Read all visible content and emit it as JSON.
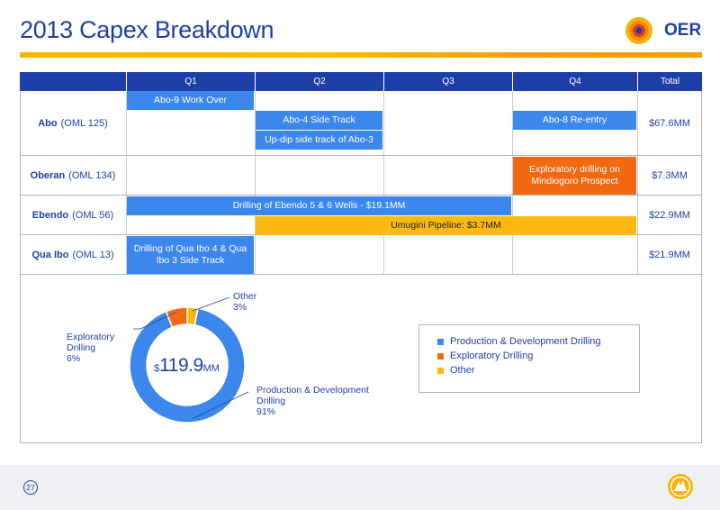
{
  "title": "2013 Capex Breakdown",
  "logo": {
    "text": "OER"
  },
  "footer": {
    "page": "27"
  },
  "colors": {
    "navy": "#1f3fa8",
    "blue": "#3b87eb",
    "orange": "#f06a14",
    "yellow": "#fcb912"
  },
  "schedule": {
    "columns": [
      "Q1",
      "Q2",
      "Q3",
      "Q4",
      "Total"
    ],
    "rows": [
      {
        "name": "Abo",
        "license": "(OML 125)",
        "total": "$67.6MM",
        "activities": [
          {
            "label": "Abo-9 Work Over",
            "start": "Q1",
            "end": "Q1",
            "color": "blue",
            "lane": 0
          },
          {
            "label": "Abo-4 Side Track",
            "start": "Q2",
            "end": "Q2",
            "color": "blue",
            "lane": 1
          },
          {
            "label": "Up-dip side track of Abo-3",
            "start": "Q2",
            "end": "Q2",
            "color": "blue",
            "lane": 2
          },
          {
            "label": "Abo-8 Re-entry",
            "start": "Q4",
            "end": "Q4",
            "color": "blue",
            "lane": 1
          }
        ]
      },
      {
        "name": "Oberan",
        "license": "(OML 134)",
        "total": "$7.3MM",
        "activities": [
          {
            "label": "Exploratory drilling on Mindiogoro Prospect",
            "start": "Q4",
            "end": "Q4",
            "color": "orange",
            "lane": 0
          }
        ]
      },
      {
        "name": "Ebendo",
        "license": "(OML 56)",
        "total": "$22.9MM",
        "activities": [
          {
            "label": "Drilling of Ebendo 5 & 6 Wells - $19.1MM",
            "start": "Q1",
            "end": "Q3",
            "color": "blue",
            "lane": 0
          },
          {
            "label": "Umugini Pipeline: $3.7MM",
            "start": "Q2",
            "end": "Q4",
            "color": "yellow",
            "lane": 1
          }
        ]
      },
      {
        "name": "Qua Ibo",
        "license": "(OML 13)",
        "total": "$21.9MM",
        "activities": [
          {
            "label": "Drilling of Qua Ibo 4 & Qua Ibo 3 Side Track",
            "start": "Q1",
            "end": "Q1",
            "color": "blue",
            "lane": 0
          }
        ]
      }
    ]
  },
  "chart_data": {
    "type": "pie",
    "variant": "donut",
    "center_label": {
      "currency": "$",
      "value": "119.9",
      "unit": "MM"
    },
    "slices": [
      {
        "label": "Production & Development Drilling",
        "label_lines": [
          "Production & Development",
          "Drilling"
        ],
        "percent_label": "91%",
        "value": 91,
        "color": "#3b87eb"
      },
      {
        "label": "Exploratory Drilling",
        "label_lines": [
          "Exploratory",
          "Drilling"
        ],
        "percent_label": "6%",
        "value": 6,
        "color": "#f06a14"
      },
      {
        "label": "Other",
        "label_lines": [
          "Other"
        ],
        "percent_label": "3%",
        "value": 3,
        "color": "#fcb912"
      }
    ],
    "legend": [
      "Production & Development Drilling",
      "Exploratory Drilling",
      "Other"
    ],
    "legend_placement": "right"
  }
}
